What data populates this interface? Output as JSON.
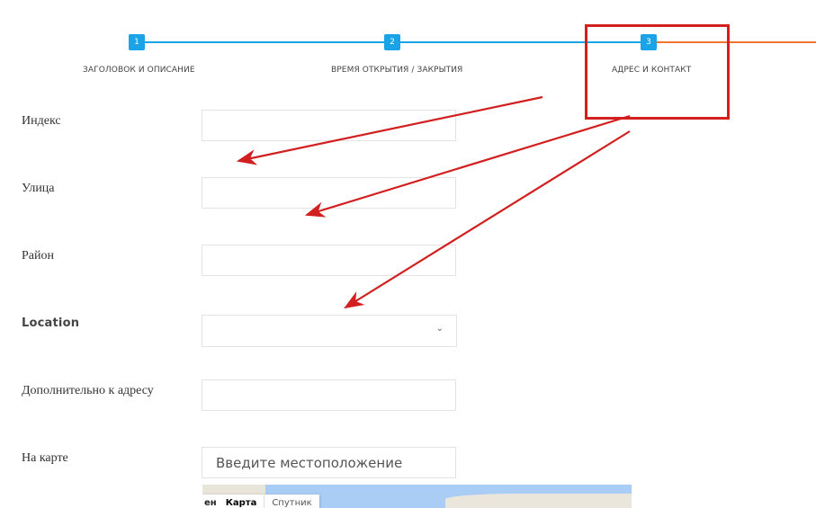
{
  "steps": [
    {
      "number": "1",
      "label": "ЗАГОЛОВОК И ОПИСАНИЕ"
    },
    {
      "number": "2",
      "label": "ВРЕМЯ ОТКРЫТИЯ / ЗАКРЫТИЯ"
    },
    {
      "number": "3",
      "label": "АДРЕС И КОНТАКТ"
    }
  ],
  "colors": {
    "done": "#1aa3e6",
    "pending": "#f0732a",
    "annotation": "#d21f1f"
  },
  "fields": {
    "index_label": "Индекс",
    "index_value": "",
    "street_label": "Улица",
    "street_value": "",
    "district_label": "Район",
    "district_value": "",
    "location_label": "Location",
    "location_value": "",
    "additional_label": "Дополнительно к адресу",
    "additional_value": "",
    "map_label": "На карте",
    "map_search_placeholder": "Введите местоположение"
  },
  "map": {
    "tab_cut": "ен",
    "tab_map": "Карта",
    "tab_satellite": "Спутник",
    "select_icon": "chevron-down-icon"
  }
}
